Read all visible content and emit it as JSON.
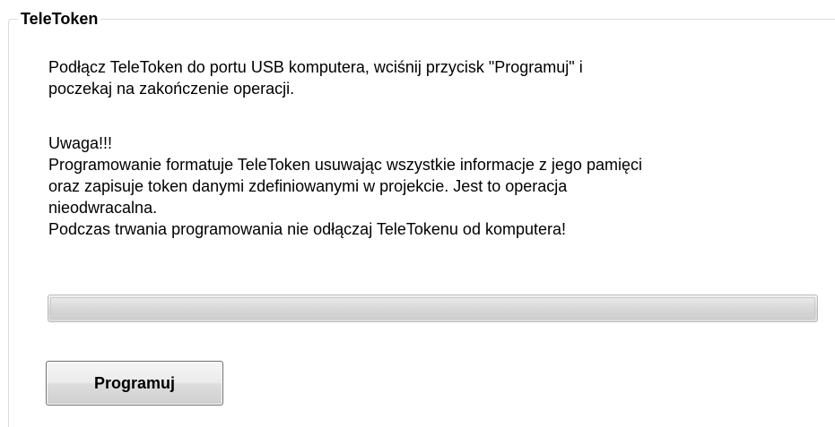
{
  "group": {
    "title": "TeleToken"
  },
  "instructions": {
    "lines": [
      "Podłącz TeleToken do portu USB komputera, wciśnij przycisk \"Programuj\" i",
      "poczekaj na zakończenie operacji."
    ]
  },
  "warning": {
    "heading": "Uwaga!!!",
    "lines": [
      "Programowanie formatuje TeleToken usuwając wszystkie informacje z jego pamięci",
      "oraz zapisuje token danymi zdefiniowanymi w projekcie. Jest to operacja",
      "nieodwracalna.",
      "Podczas trwania programowania nie odłączaj TeleTokenu od komputera!"
    ]
  },
  "progress": {
    "value": 0
  },
  "actions": {
    "program_label": "Programuj"
  }
}
